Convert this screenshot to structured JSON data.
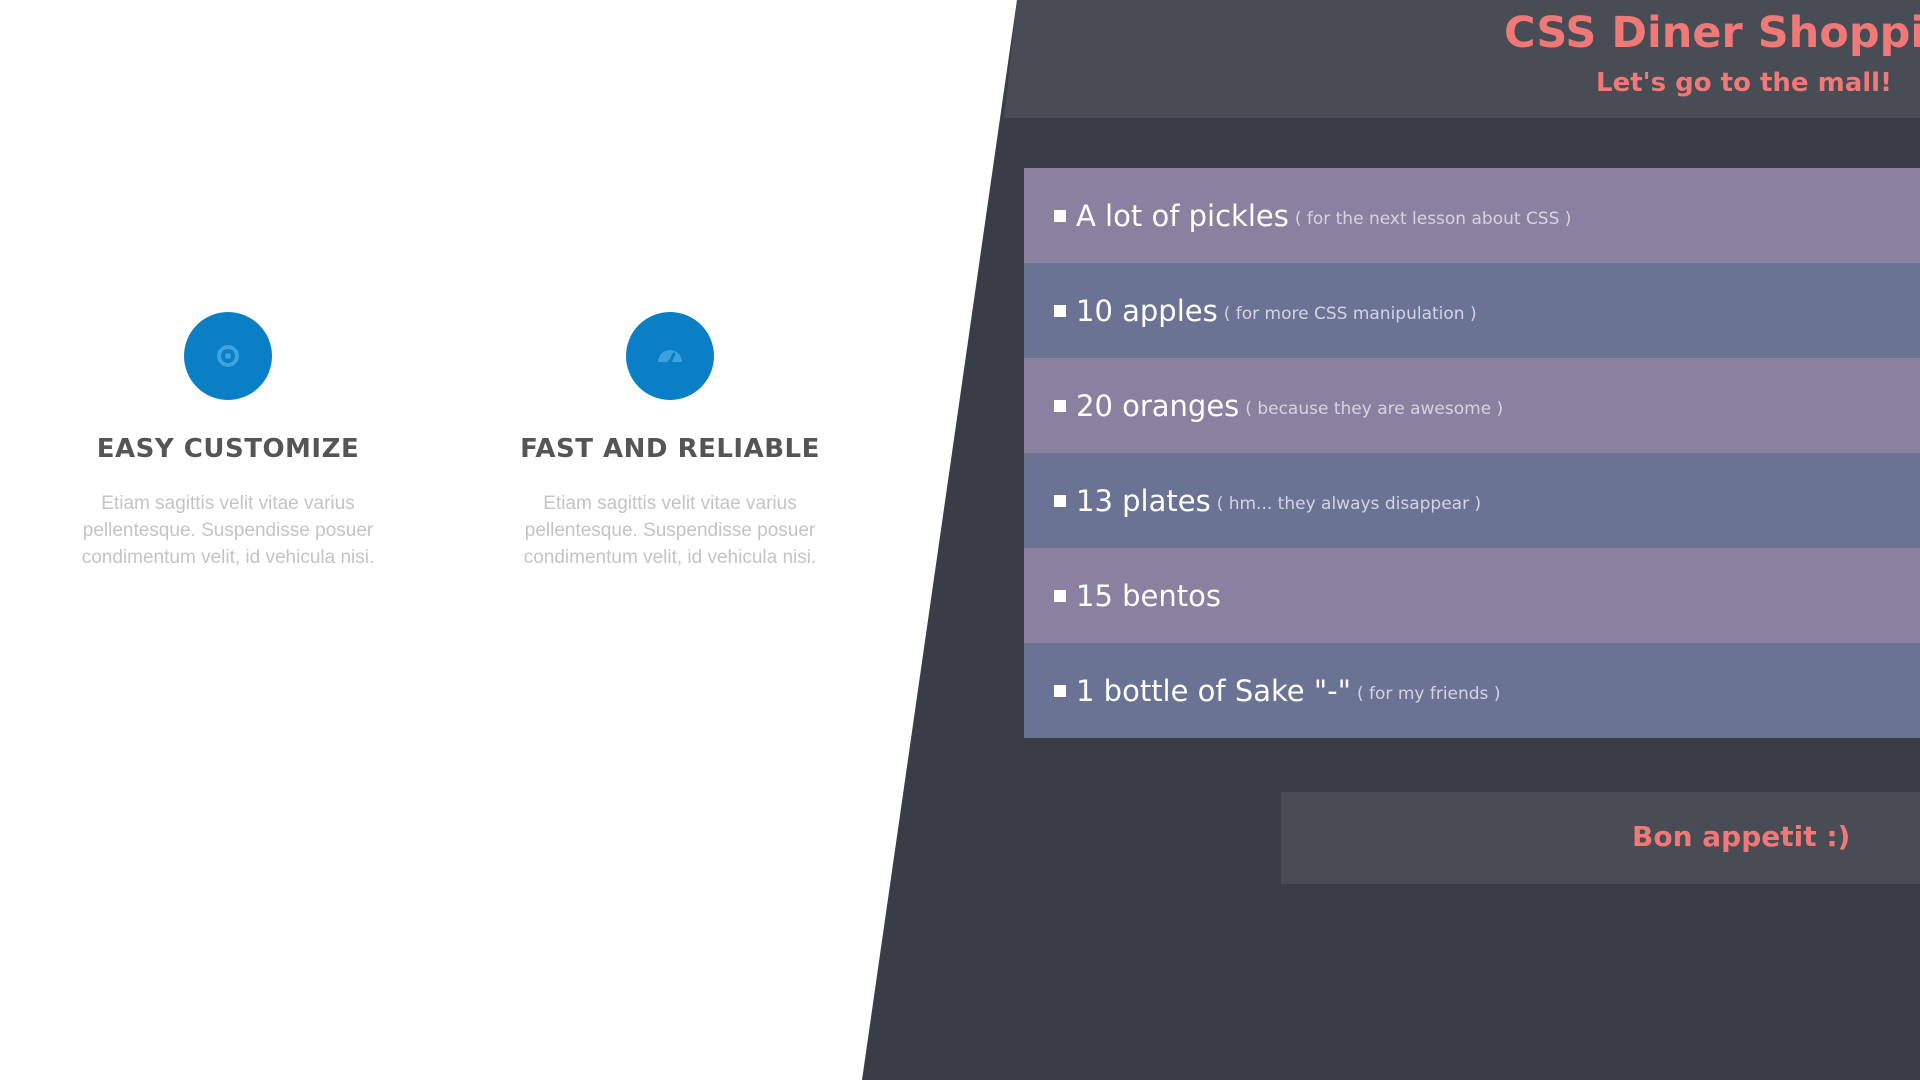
{
  "features": [
    {
      "icon": "gear-icon",
      "title": "EASY CUSTOMIZE",
      "description": "Etiam sagittis velit vitae varius pellentesque. Suspendisse posuer condimentum velit, id vehicula nisi."
    },
    {
      "icon": "speedometer-icon",
      "title": "FAST AND RELIABLE",
      "description": "Etiam sagittis velit vitae varius pellentesque. Suspendisse posuer condimentum velit, id vehicula nisi."
    }
  ],
  "panel": {
    "title": "CSS Diner Shopping List",
    "subtitle": "Let's go to the mall!"
  },
  "shopping_list": [
    {
      "text": "A lot of pickles",
      "note": "( for the next lesson about CSS )"
    },
    {
      "text": "10 apples",
      "note": "( for more CSS manipulation )"
    },
    {
      "text": "20 oranges",
      "note": "( because they are awesome )"
    },
    {
      "text": "13 plates",
      "note": "( hm... they always disappear )"
    },
    {
      "text": "15 bentos",
      "note": ""
    },
    {
      "text": "1 bottle of Sake \"-\"",
      "note": "( for my friends )"
    }
  ],
  "footer": {
    "text": "Bon appetit :)"
  },
  "colors": {
    "feature_icon_bg": "#0a7fc6",
    "panel_bg": "#393d47",
    "panel_header_bg": "#474c55",
    "accent_text": "#f07876",
    "list_row_odd": "#8a81a1",
    "list_row_even": "#6a7394"
  }
}
